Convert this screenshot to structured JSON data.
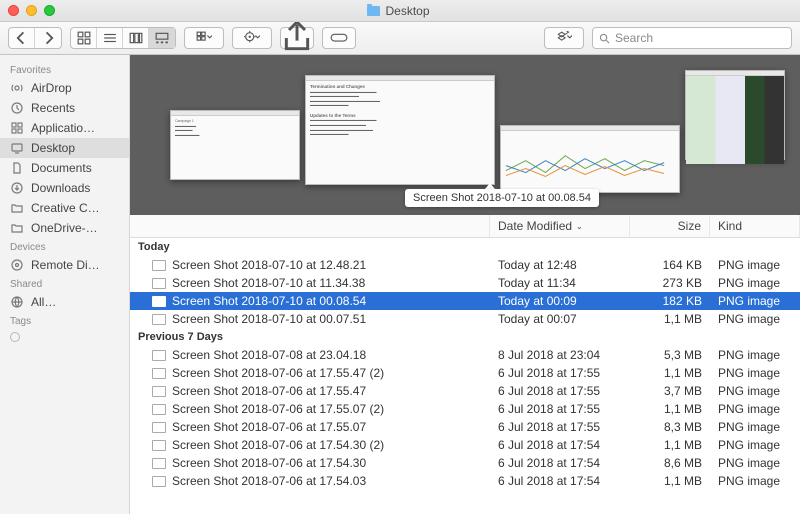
{
  "window": {
    "title": "Desktop"
  },
  "search": {
    "placeholder": "Search"
  },
  "sidebar": {
    "sections": [
      {
        "heading": "Favorites",
        "items": [
          {
            "icon": "airdrop",
            "label": "AirDrop"
          },
          {
            "icon": "recents",
            "label": "Recents"
          },
          {
            "icon": "apps",
            "label": "Applicatio…"
          },
          {
            "icon": "desktop",
            "label": "Desktop",
            "selected": true
          },
          {
            "icon": "documents",
            "label": "Documents"
          },
          {
            "icon": "downloads",
            "label": "Downloads"
          },
          {
            "icon": "folder",
            "label": "Creative C…"
          },
          {
            "icon": "folder",
            "label": "OneDrive-…"
          }
        ]
      },
      {
        "heading": "Devices",
        "items": [
          {
            "icon": "disk",
            "label": "Remote Di…"
          }
        ]
      },
      {
        "heading": "Shared",
        "items": [
          {
            "icon": "network",
            "label": "All…"
          }
        ]
      },
      {
        "heading": "Tags",
        "items": []
      }
    ]
  },
  "gallery": {
    "selected_caption": "Screen Shot 2018-07-10 at 00.08.54"
  },
  "columns": {
    "name": "Name",
    "date": "Date Modified",
    "size": "Size",
    "kind": "Kind"
  },
  "groups": [
    {
      "label": "Today",
      "rows": [
        {
          "name": "Screen Shot 2018-07-10 at 12.48.21",
          "date": "Today at 12:48",
          "size": "164 KB",
          "kind": "PNG image"
        },
        {
          "name": "Screen Shot 2018-07-10 at 11.34.38",
          "date": "Today at 11:34",
          "size": "273 KB",
          "kind": "PNG image"
        },
        {
          "name": "Screen Shot 2018-07-10 at 00.08.54",
          "date": "Today at 00:09",
          "size": "182 KB",
          "kind": "PNG image",
          "selected": true
        },
        {
          "name": "Screen Shot 2018-07-10 at 00.07.51",
          "date": "Today at 00:07",
          "size": "1,1 MB",
          "kind": "PNG image"
        }
      ]
    },
    {
      "label": "Previous 7 Days",
      "rows": [
        {
          "name": "Screen Shot 2018-07-08 at 23.04.18",
          "date": "8 Jul 2018 at 23:04",
          "size": "5,3 MB",
          "kind": "PNG image"
        },
        {
          "name": "Screen Shot 2018-07-06 at 17.55.47 (2)",
          "date": "6 Jul 2018 at 17:55",
          "size": "1,1 MB",
          "kind": "PNG image"
        },
        {
          "name": "Screen Shot 2018-07-06 at 17.55.47",
          "date": "6 Jul 2018 at 17:55",
          "size": "3,7 MB",
          "kind": "PNG image"
        },
        {
          "name": "Screen Shot 2018-07-06 at 17.55.07 (2)",
          "date": "6 Jul 2018 at 17:55",
          "size": "1,1 MB",
          "kind": "PNG image"
        },
        {
          "name": "Screen Shot 2018-07-06 at 17.55.07",
          "date": "6 Jul 2018 at 17:55",
          "size": "8,3 MB",
          "kind": "PNG image"
        },
        {
          "name": "Screen Shot 2018-07-06 at 17.54.30 (2)",
          "date": "6 Jul 2018 at 17:54",
          "size": "1,1 MB",
          "kind": "PNG image"
        },
        {
          "name": "Screen Shot 2018-07-06 at 17.54.30",
          "date": "6 Jul 2018 at 17:54",
          "size": "8,6 MB",
          "kind": "PNG image"
        },
        {
          "name": "Screen Shot 2018-07-06 at 17.54.03",
          "date": "6 Jul 2018 at 17:54",
          "size": "1,1 MB",
          "kind": "PNG image"
        }
      ]
    }
  ]
}
